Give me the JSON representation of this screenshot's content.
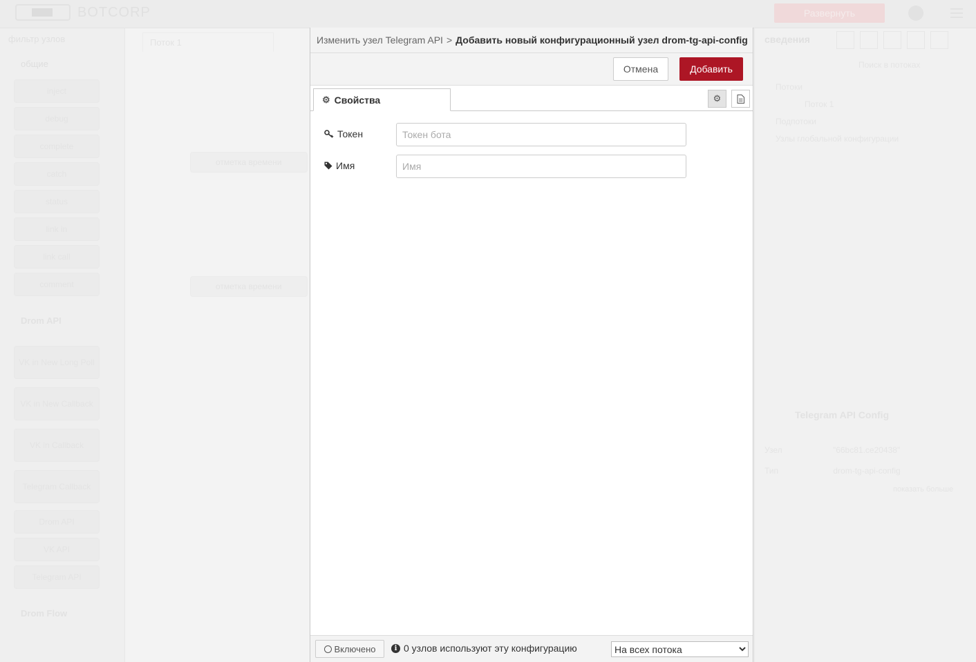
{
  "background": {
    "logo_text": "BOTCORP",
    "deploy_label": "Развернуть",
    "palette": {
      "search": "фильтр узлов",
      "category_common": "общие",
      "nodes": [
        "inject",
        "debug",
        "complete",
        "catch",
        "status",
        "link in",
        "link call",
        "comment"
      ],
      "category_drom_api": "Drom API",
      "drom_nodes": [
        "VK in New Long Poll",
        "VK in New Callback",
        "VK in Callback",
        "Telegram Callback",
        "Drom API",
        "VK API",
        "Telegram API"
      ],
      "category_drom_flow": "Drom Flow"
    },
    "workspace": {
      "tab": "Поток 1",
      "node_1": "отметка времени",
      "node_2": "отметка времени"
    },
    "sidebar": {
      "title": "сведения",
      "search": "Поиск в потоках",
      "tree_flows": "Потоки",
      "tree_flow1": "Поток 1",
      "tree_subflows": "Подпотоки",
      "tree_global": "Узлы глобальной конфигурации",
      "card_title": "Telegram API Config",
      "kv": [
        {
          "k": "Узел",
          "v": "\"66bc81.ce20438\""
        },
        {
          "k": "Тип",
          "v": "drom-tg-api-config"
        }
      ],
      "more": "показать больше"
    }
  },
  "dialog": {
    "breadcrumb_parent": "Изменить узел Telegram API",
    "breadcrumb_sep": ">",
    "breadcrumb_current": "Добавить новый конфигурационный узел drom-tg-api-config",
    "cancel_label": "Отмена",
    "add_label": "Добавить",
    "tab_properties": "Свойства",
    "fields": {
      "token": {
        "label": "Токен",
        "placeholder": "Токен бота",
        "value": ""
      },
      "name": {
        "label": "Имя",
        "placeholder": "Имя",
        "value": ""
      }
    },
    "footer": {
      "enabled_label": "Включено",
      "usage_text": "0 узлов используют эту конфигурацию",
      "scope_selected": "На всех потока"
    }
  },
  "icons": {
    "gear": "gear-icon",
    "key": "key-icon",
    "tag": "tag-icon",
    "doc": "document-icon",
    "info": "info-icon"
  },
  "colors": {
    "primary": "#ad1625",
    "dialog_bg": "#ffffff",
    "header_bg": "#f3f3f3"
  }
}
